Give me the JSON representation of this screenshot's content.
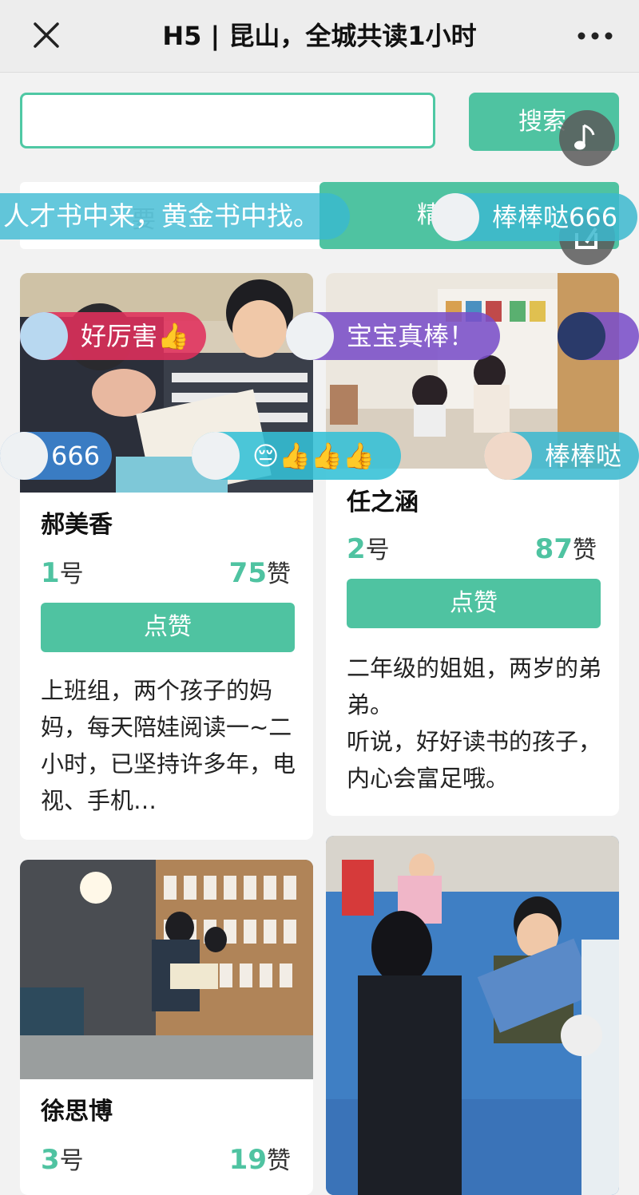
{
  "header": {
    "title": "H5 | 昆山，全城共读1小时"
  },
  "search": {
    "placeholder": "",
    "button_label": "搜索"
  },
  "banner": {
    "faded_text": "要",
    "scroll_text": "人才书中来，黄金书中找。",
    "tag_label": "精"
  },
  "cards": [
    {
      "name": "郝美香",
      "number": "1",
      "number_suffix": "号",
      "likes": "75",
      "likes_suffix": "赞",
      "like_button": "点赞",
      "desc": "上班组，两个孩子的妈妈，每天陪娃阅读一~二小时，已坚持许多年，电视、手机…"
    },
    {
      "name": "任之涵",
      "number": "2",
      "number_suffix": "号",
      "likes": "87",
      "likes_suffix": "赞",
      "like_button": "点赞",
      "desc": "二年级的姐姐，两岁的弟弟。\n听说，好好读书的孩子，内心会富足哦。"
    },
    {
      "name": "徐思博",
      "number": "3",
      "number_suffix": "号",
      "likes": "19",
      "likes_suffix": "赞"
    }
  ],
  "danmaku": [
    {
      "text": "棒棒哒666",
      "color": "#3cb8cf"
    },
    {
      "text": "好厉害👍",
      "color": "#e0305c"
    },
    {
      "text": "宝宝真棒！",
      "color": "#7a4fc8"
    },
    {
      "text": "666",
      "color": "#3c88d6"
    },
    {
      "text": "😔👍👍👍",
      "color": "#33c0d6"
    },
    {
      "text": "棒棒哒",
      "color": "#3cb8cf"
    }
  ],
  "colors": {
    "accent": "#4fc3a1",
    "background": "#f2f2f2"
  }
}
